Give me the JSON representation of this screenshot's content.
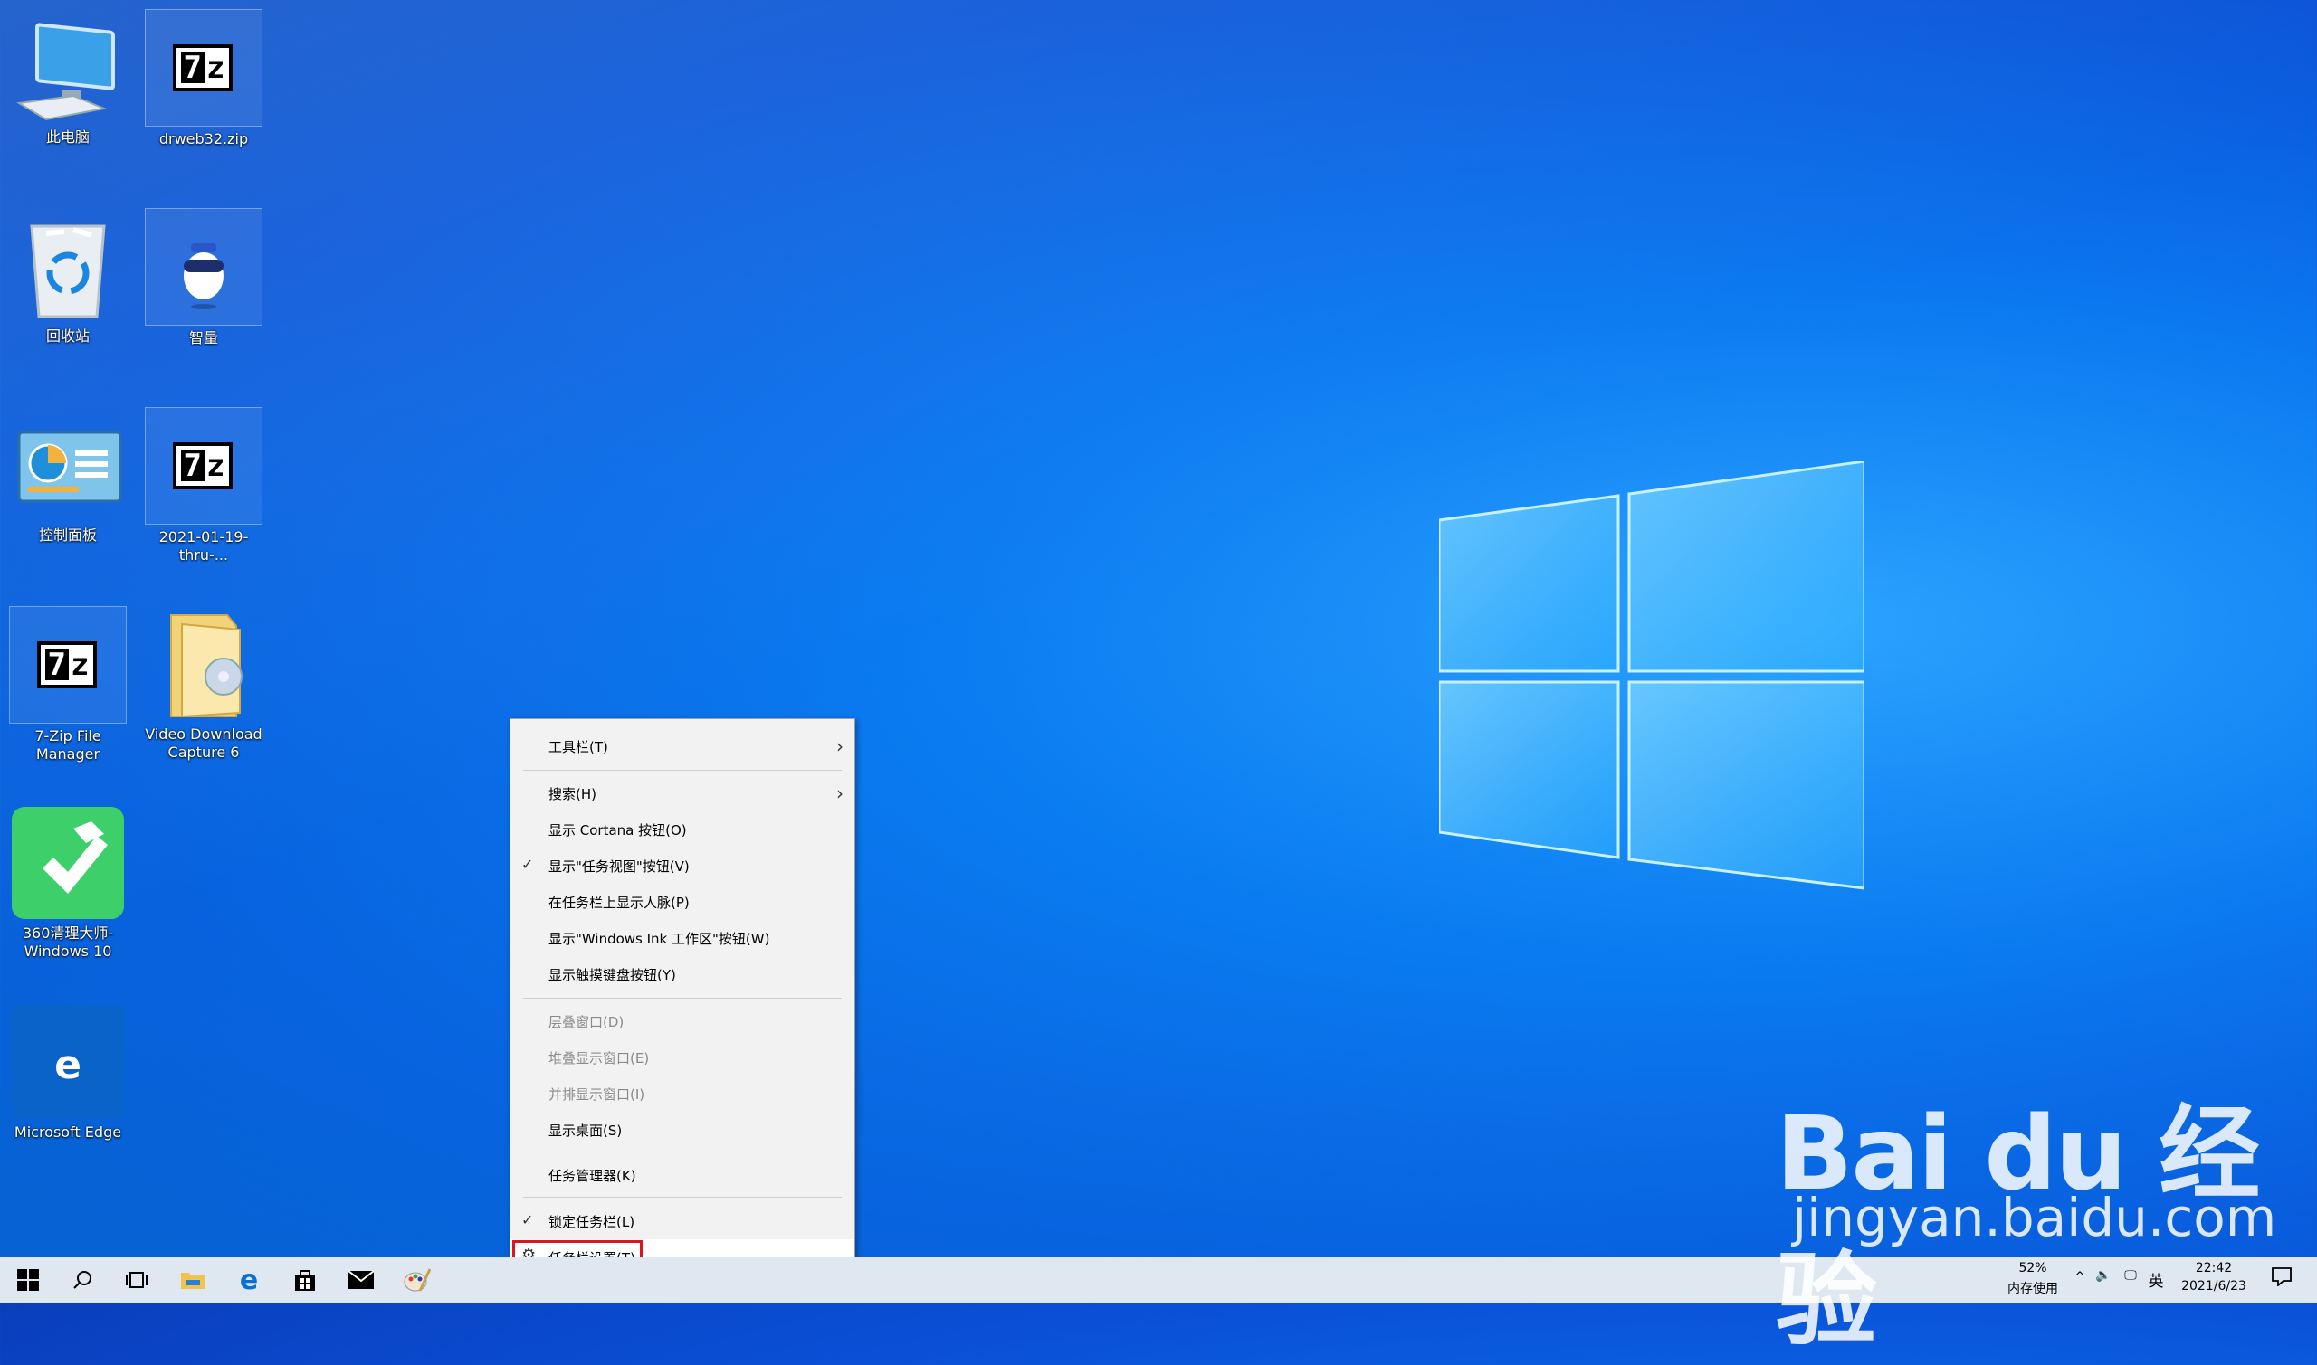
{
  "desktop": {
    "icons": [
      {
        "label": "此电脑",
        "icon": "computer-icon"
      },
      {
        "label": "drweb32.zip",
        "icon": "7zip-archive-icon"
      },
      {
        "label": "回收站",
        "icon": "recycle-bin-icon"
      },
      {
        "label": "智量",
        "icon": "robot-app-icon"
      },
      {
        "label": "控制面板",
        "icon": "control-panel-icon"
      },
      {
        "label": "2021-01-19-thru-...",
        "icon": "7zip-archive-icon"
      },
      {
        "label": "7-Zip File Manager",
        "icon": "7zip-app-icon"
      },
      {
        "label": "Video Download Capture 6",
        "icon": "folder-icon"
      },
      {
        "label": "360清理大师-Windows 10",
        "icon": "cleaner-app-icon"
      },
      {
        "label": "Microsoft Edge",
        "icon": "edge-icon"
      }
    ]
  },
  "context_menu": {
    "items": [
      {
        "label": "工具栏(T)",
        "submenu": true
      },
      {
        "label": "搜索(H)",
        "submenu": true
      },
      {
        "label": "显示 Cortana 按钮(O)"
      },
      {
        "label": "显示\"任务视图\"按钮(V)",
        "checked": true
      },
      {
        "label": "在任务栏上显示人脉(P)"
      },
      {
        "label": "显示\"Windows Ink 工作区\"按钮(W)"
      },
      {
        "label": "显示触摸键盘按钮(Y)"
      },
      {
        "label": "层叠窗口(D)",
        "disabled": true
      },
      {
        "label": "堆叠显示窗口(E)",
        "disabled": true
      },
      {
        "label": "并排显示窗口(I)",
        "disabled": true
      },
      {
        "label": "显示桌面(S)"
      },
      {
        "label": "任务管理器(K)"
      },
      {
        "label": "锁定任务栏(L)",
        "checked": true
      },
      {
        "label": "任务栏设置(T)",
        "highlighted": true,
        "icon": "gear-icon"
      }
    ]
  },
  "taskbar": {
    "buttons": [
      "start-icon",
      "search-icon",
      "task-view-icon",
      "file-explorer-icon",
      "edge-icon",
      "store-icon",
      "mail-icon",
      "paint-icon"
    ],
    "tray": {
      "memory_percent": "52%",
      "memory_label": "内存使用",
      "ime": "英",
      "time": "22:42",
      "date": "2021/6/23"
    }
  },
  "watermark": {
    "brand": "Bai du 经验",
    "url": "jingyan.baidu.com"
  }
}
